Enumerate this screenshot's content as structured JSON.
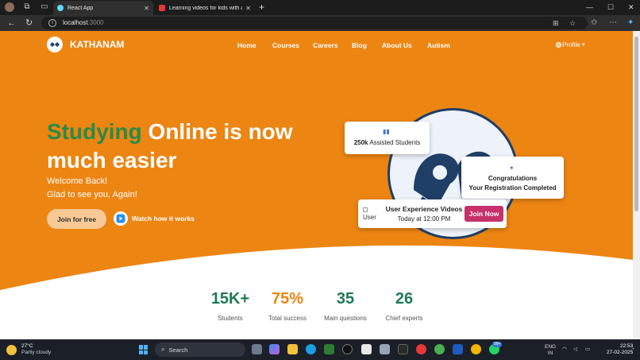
{
  "browser": {
    "tabs": [
      {
        "title": "React App",
        "active": true
      },
      {
        "title": "Learning videos for kids with autism",
        "active": false
      }
    ],
    "address": {
      "host": "localhost",
      "port": ":3000"
    }
  },
  "site": {
    "brand": "KATHANAM",
    "nav": [
      "Home",
      "Courses",
      "Careers",
      "Blog",
      "About Us",
      "Autism"
    ],
    "profile_label": "Profile",
    "headline": {
      "accent": "Studying",
      "rest": " Online is now much easier"
    },
    "welcome_line1": "Welcome Back!",
    "welcome_line2": "Glad to see you, Again!",
    "join_button": "Join for free",
    "watch_link": "Watch how it works",
    "cards": {
      "assisted": {
        "count": "250k",
        "text": " Assisted Students"
      },
      "congrats": {
        "title": "Congratulations",
        "subtitle": "Your Registration Completed"
      },
      "webinar": {
        "img_alt": "User",
        "title": "User Experience Videos",
        "time": "Today at 12:00 PM",
        "button": "Join Now"
      }
    },
    "stats": [
      {
        "value": "15K+",
        "label": "Students",
        "color": "#1f7a53"
      },
      {
        "value": "75%",
        "label": "Total success",
        "color": "#ec8512"
      },
      {
        "value": "35",
        "label": "Main questions",
        "color": "#1f7a53"
      },
      {
        "value": "26",
        "label": "Chief experts",
        "color": "#1f7a53"
      }
    ],
    "colors": {
      "primary": "#ec8512",
      "accent_green": "#2a8a48",
      "join_now": "#c6306b"
    }
  },
  "taskbar": {
    "weather_temp": "27°C",
    "weather_desc": "Partly cloudy",
    "search_placeholder": "Search",
    "notification_badge": "99+",
    "lang_top": "ENG",
    "lang_bottom": "IN",
    "time": "22:53",
    "date": "27-02-2025"
  }
}
